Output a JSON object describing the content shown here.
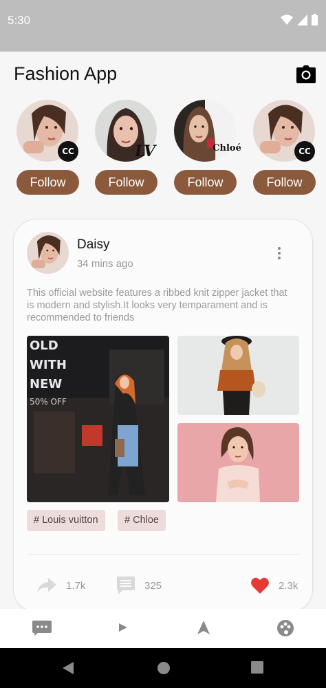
{
  "status_bar": {
    "time": "5:30"
  },
  "header": {
    "title": "Fashion App"
  },
  "stories": [
    {
      "follow_label": "Follow",
      "brand": "chanel"
    },
    {
      "follow_label": "Follow",
      "brand": "louis-vuitton"
    },
    {
      "follow_label": "Follow",
      "brand": "chloe",
      "brand_text": "Chloé"
    },
    {
      "follow_label": "Follow",
      "brand": "chanel"
    }
  ],
  "post": {
    "author": "Daisy",
    "time_ago": "34 mins ago",
    "text": "This official website features a ribbed knit zipper jacket that is modern and stylish.It looks very temparament and is recommended to friends",
    "photo_overlay": {
      "line1": "OLD",
      "line2": "WITH",
      "line3": "NEW",
      "line4": "50% OFF"
    },
    "tags": [
      "# Louis vuitton",
      "# Chloe"
    ],
    "shares": "1.7k",
    "comments": "325",
    "likes": "2.3k"
  },
  "colors": {
    "accent": "#8b5a3c",
    "tag_bg": "#ecdcdc",
    "heart": "#e53935"
  },
  "bottom_nav": [
    "chat-icon",
    "play-icon",
    "navigation-icon",
    "palette-icon"
  ]
}
